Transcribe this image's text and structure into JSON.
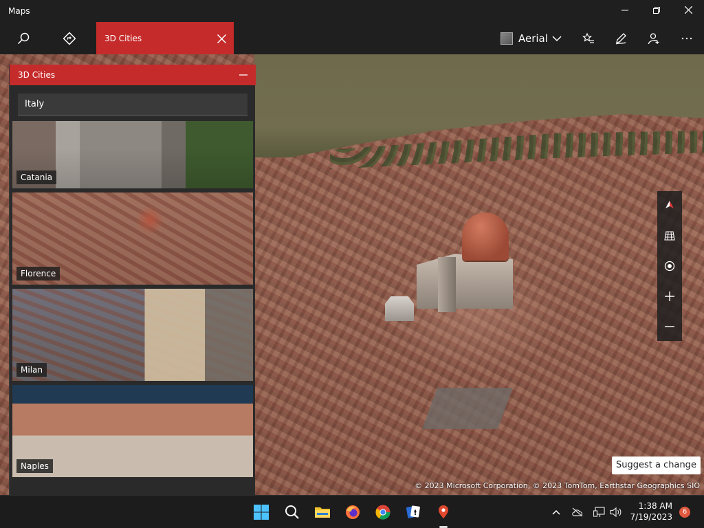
{
  "app": {
    "title": "Maps"
  },
  "window_controls": {
    "minimize": "minimize-icon",
    "maximize": "maximize-icon",
    "close": "close-icon"
  },
  "toolbar": {
    "search_icon": "search-icon",
    "directions_icon": "directions-icon",
    "active_tab_label": "3D Cities",
    "map_style_label": "Aerial",
    "favorites_icon": "favorites-icon",
    "ink_icon": "pen-icon",
    "account_icon": "add-user-icon",
    "more_icon": "more-icon"
  },
  "panel": {
    "title": "3D Cities",
    "region": "Italy",
    "cities": [
      {
        "name": "Catania"
      },
      {
        "name": "Florence"
      },
      {
        "name": "Milan"
      },
      {
        "name": "Naples"
      }
    ]
  },
  "map": {
    "suggest_label": "Suggest a change",
    "attribution": "© 2023 Microsoft Corporation, © 2023 TomTom, Earthstar Geographics  SIO"
  },
  "map_controls": [
    "compass-icon",
    "grid-icon",
    "locate-icon",
    "zoom-in-icon",
    "zoom-out-icon"
  ],
  "taskbar": {
    "apps": [
      "windows-start-icon",
      "search-icon",
      "file-explorer-icon",
      "firefox-icon",
      "chrome-icon",
      "solitaire-icon",
      "maps-icon"
    ],
    "time": "1:38 AM",
    "date": "7/19/2023",
    "notification_count": "6"
  },
  "colors": {
    "accent": "#c62b2b",
    "chrome": "#1f1f1f",
    "panel": "#2a2a2a"
  }
}
